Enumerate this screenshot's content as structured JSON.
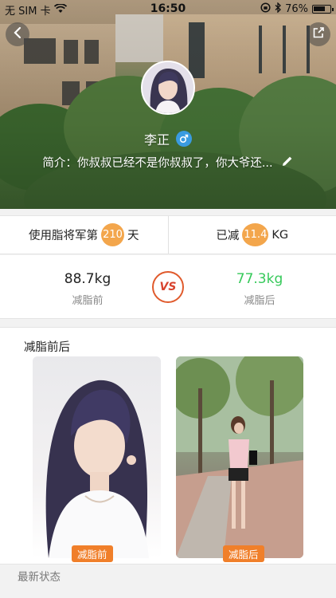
{
  "statusbar": {
    "carrier": "无 SIM 卡",
    "time": "16:50",
    "battery_text": "76%",
    "battery_level": 0.76
  },
  "profile": {
    "name": "李正",
    "gender_icon": "male-symbol-icon",
    "bio": "简介：你叔叔已经不是你叔叔了，你大爷还..."
  },
  "stats": {
    "days_prefix": "使用脂将军第",
    "days_value": "210",
    "days_suffix": "天",
    "lost_prefix": "已减",
    "lost_value": "11.4",
    "lost_unit": "KG"
  },
  "compare": {
    "before_weight": "88.7kg",
    "before_label": "减脂前",
    "vs_text": "VS",
    "after_weight": "77.3kg",
    "after_label": "减脂后"
  },
  "photos": {
    "title": "减脂前后",
    "before_tag": "减脂前",
    "after_tag": "减脂后"
  },
  "feed": {
    "title": "最新状态"
  },
  "colors": {
    "accent_orange": "#f3a64c",
    "tag_orange": "#f07f2a",
    "after_green": "#36c95a",
    "vs_red": "#d8432e",
    "gender_blue": "#3a9be0"
  }
}
